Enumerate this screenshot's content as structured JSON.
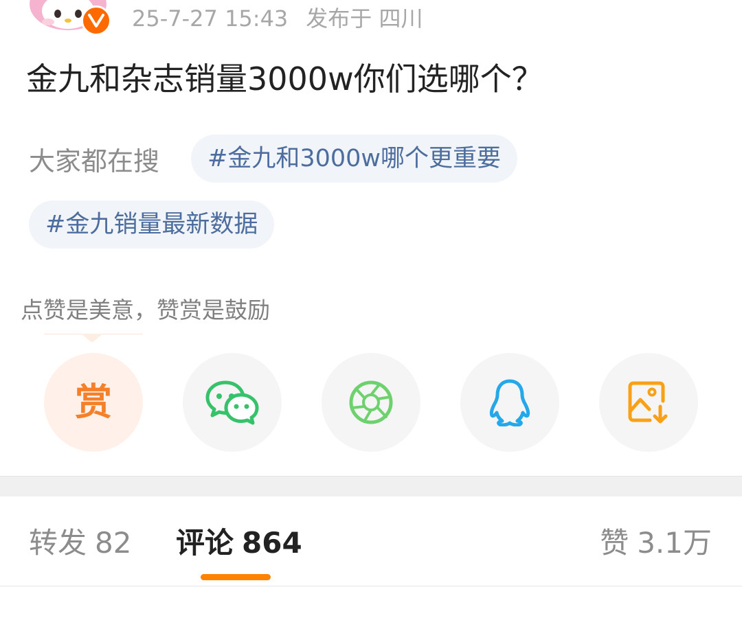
{
  "post": {
    "timestamp": "25-7-27 15:43",
    "location": "发布于 四川",
    "title": "金九和杂志销量3000w你们选哪个？"
  },
  "trending": {
    "label": "大家都在搜",
    "tags": [
      "#金九和3000w哪个更重要",
      "#金九销量最新数据"
    ]
  },
  "reward_hint": "点赞是美意，赞赏是鼓励",
  "share": {
    "reward_label": "赏",
    "icons": [
      "reward-icon",
      "wechat-icon",
      "moments-icon",
      "qq-icon",
      "save-image-icon"
    ],
    "colors": {
      "reward": "#f5802a",
      "wechat": "#35c26a",
      "moments": "#6dd16e",
      "qq": "#24a8ea",
      "save_image": "#f8a116"
    }
  },
  "tabs": {
    "reposts_label": "转发",
    "reposts_count": "82",
    "comments_label": "评论",
    "comments_count": "864",
    "likes_label": "赞",
    "likes_count": "3.1万"
  },
  "colors": {
    "accent": "#ff8200",
    "link": "#4c6d9d",
    "verified": "#ff6a00"
  }
}
